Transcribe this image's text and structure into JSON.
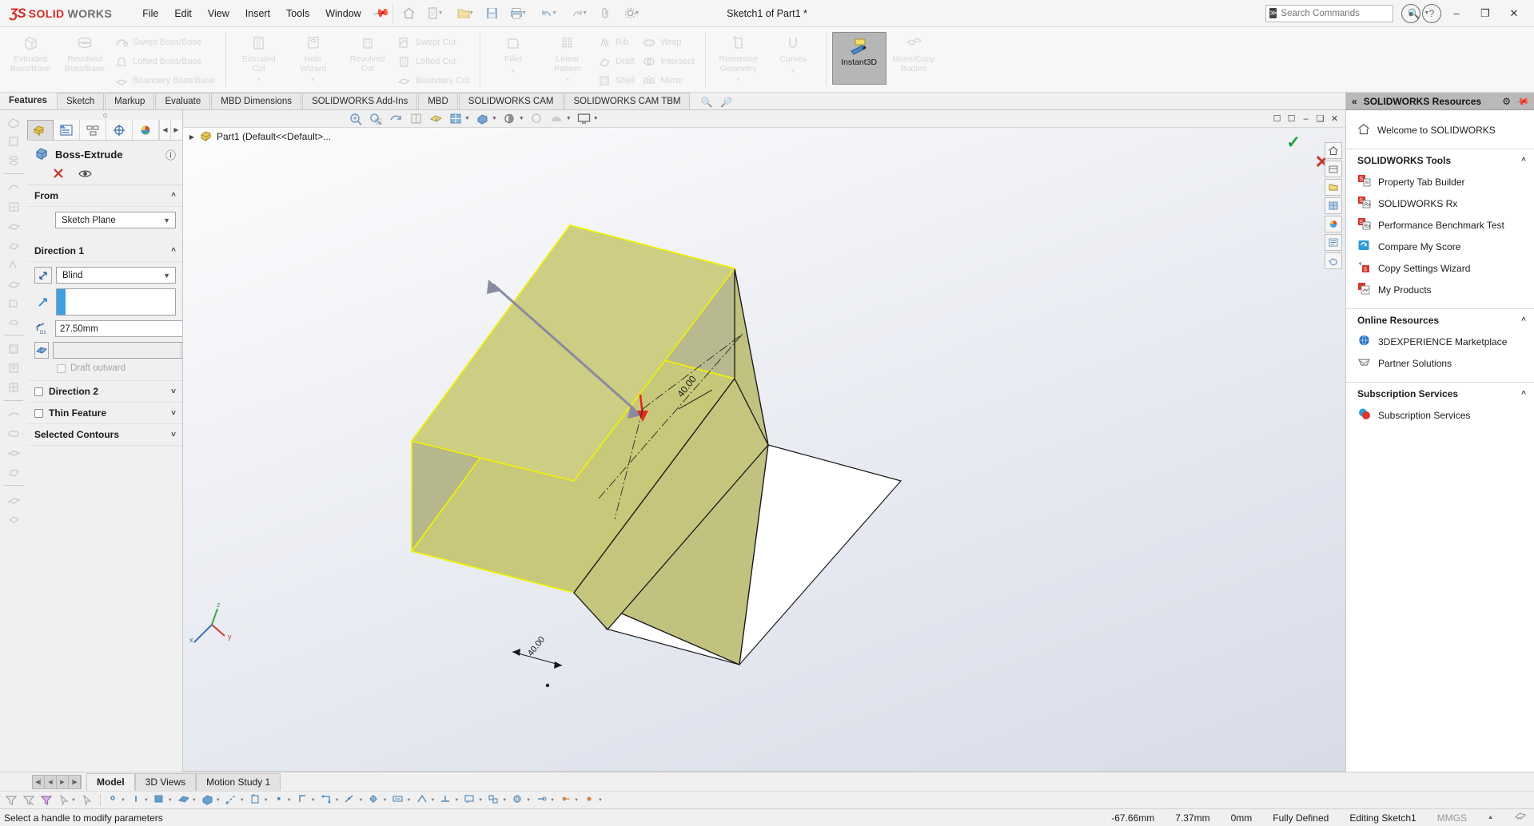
{
  "app": {
    "brand_ds": "ƷS",
    "brand_solid": "SOLID",
    "brand_works": "WORKS",
    "document_title": "Sketch1 of Part1 *",
    "accent_red": "#d32b28",
    "accent_blue": "#3e9fe0",
    "accent_green": "#1a9c2b"
  },
  "menubar": {
    "items": [
      {
        "label": "File"
      },
      {
        "label": "Edit"
      },
      {
        "label": "View"
      },
      {
        "label": "Insert"
      },
      {
        "label": "Tools"
      },
      {
        "label": "Window"
      }
    ],
    "pin_icon": "pin-icon"
  },
  "search": {
    "placeholder": "Search Commands",
    "value": ""
  },
  "window_controls": {
    "minimize": "–",
    "restore": "❐",
    "close": "✕",
    "account": "account-icon",
    "help": "help-icon"
  },
  "ribbon": {
    "groups": [
      {
        "name": "features-primary",
        "big": [
          {
            "label": "Extruded\nBoss/Base",
            "icon": "extruded-boss-icon",
            "dropdown": false
          },
          {
            "label": "Revolved\nBoss/Base",
            "icon": "revolved-boss-icon",
            "dropdown": false
          }
        ],
        "small": [
          {
            "label": "Swept Boss/Base",
            "icon": "swept-boss-icon"
          },
          {
            "label": "Lofted Boss/Base",
            "icon": "lofted-boss-icon"
          },
          {
            "label": "Boundary Boss/Base",
            "icon": "boundary-boss-icon"
          }
        ]
      },
      {
        "name": "cut-features",
        "big": [
          {
            "label": "Extruded\nCut",
            "icon": "extruded-cut-icon",
            "dropdown": true
          },
          {
            "label": "Hole\nWizard",
            "icon": "hole-wizard-icon",
            "dropdown": true
          },
          {
            "label": "Revolved\nCut",
            "icon": "revolved-cut-icon",
            "dropdown": false
          }
        ],
        "small": [
          {
            "label": "Swept Cut",
            "icon": "swept-cut-icon"
          },
          {
            "label": "Lofted Cut",
            "icon": "lofted-cut-icon"
          },
          {
            "label": "Boundary Cut",
            "icon": "boundary-cut-icon"
          }
        ]
      },
      {
        "name": "modify-features",
        "big": [
          {
            "label": "Fillet",
            "icon": "fillet-icon",
            "dropdown": true
          },
          {
            "label": "Linear\nPattern",
            "icon": "linear-pattern-icon",
            "dropdown": true
          }
        ],
        "small": [
          {
            "label": "Rib",
            "icon": "rib-icon"
          },
          {
            "label": "Draft",
            "icon": "draft-icon"
          },
          {
            "label": "Shell",
            "icon": "shell-icon"
          }
        ],
        "small2": [
          {
            "label": "Wrap",
            "icon": "wrap-icon"
          },
          {
            "label": "Intersect",
            "icon": "intersect-icon"
          },
          {
            "label": "Mirror",
            "icon": "mirror-icon"
          }
        ]
      },
      {
        "name": "reference-tools",
        "big": [
          {
            "label": "Reference\nGeometry",
            "icon": "reference-geometry-icon",
            "dropdown": true
          },
          {
            "label": "Curves",
            "icon": "curves-icon",
            "dropdown": true
          }
        ]
      },
      {
        "name": "instant3d-group",
        "big": [
          {
            "label": "Instant3D",
            "icon": "instant3d-icon",
            "active": true
          },
          {
            "label": "Move/Copy\nBodies",
            "icon": "move-copy-bodies-icon",
            "active": false
          }
        ]
      }
    ]
  },
  "command_tabs": {
    "items": [
      {
        "label": "Features",
        "selected": true
      },
      {
        "label": "Sketch",
        "selected": false
      },
      {
        "label": "Markup",
        "selected": false
      },
      {
        "label": "Evaluate",
        "selected": false
      },
      {
        "label": "MBD Dimensions",
        "selected": false
      },
      {
        "label": "SOLIDWORKS Add-Ins",
        "selected": false
      },
      {
        "label": "MBD",
        "selected": false
      },
      {
        "label": "SOLIDWORKS CAM",
        "selected": false
      },
      {
        "label": "SOLIDWORKS CAM TBM",
        "selected": false
      }
    ]
  },
  "property_manager": {
    "tabs": [
      {
        "name": "feature-manager-tab",
        "selected": true
      },
      {
        "name": "property-manager-tab",
        "selected": false
      },
      {
        "name": "configuration-manager-tab",
        "selected": false
      },
      {
        "name": "dimxpert-manager-tab",
        "selected": false
      },
      {
        "name": "display-manager-tab",
        "selected": false
      }
    ],
    "title": "Boss-Extrude",
    "title_icon": "boss-extrude-icon",
    "help_icon": "help-icon",
    "accept_icon": "checkmark-icon",
    "cancel_icon": "cancel-icon",
    "preview_icon": "eye-icon",
    "sections": {
      "from": {
        "label": "From",
        "condition_value": "Sketch Plane",
        "collapsed": false
      },
      "direction1": {
        "label": "Direction 1",
        "end_condition": "Blind",
        "direction_icon": "reverse-direction-icon",
        "depth_label": "D1",
        "depth_value": "27.50mm",
        "draft_value": "",
        "draft_outward_label": "Draft outward",
        "draft_outward_checked": false,
        "collapsed": false
      },
      "direction2": {
        "label": "Direction 2",
        "checked": false,
        "collapsed": true
      },
      "thin_feature": {
        "label": "Thin Feature",
        "checked": false,
        "collapsed": true
      },
      "selected_contours": {
        "label": "Selected Contours",
        "collapsed": true
      }
    }
  },
  "graphics": {
    "tree_root": "Part1  (Default<<Default>...",
    "tree_icon": "part-icon",
    "ok_badge": "✓",
    "cancel_badge": "✕",
    "hud_tools": [
      {
        "name": "zoom-to-fit-icon",
        "dropdown": false
      },
      {
        "name": "zoom-to-area-icon",
        "dropdown": false
      },
      {
        "name": "previous-view-icon",
        "dropdown": false
      },
      {
        "name": "section-view-icon",
        "dropdown": false
      },
      {
        "name": "view-orientation-icon",
        "dropdown": false
      },
      {
        "name": "display-style-icon",
        "dropdown": true
      },
      {
        "name": "hide-show-items-icon",
        "dropdown": true
      },
      {
        "name": "edit-appearance-icon",
        "dropdown": true
      },
      {
        "name": "apply-scene-icon",
        "dropdown": false
      },
      {
        "name": "view-settings-icon",
        "dropdown": true
      }
    ],
    "window_buttons": [
      {
        "name": "restore-view-icon",
        "glyph": "❐"
      },
      {
        "name": "maximize-view-icon",
        "glyph": "□"
      },
      {
        "name": "minimize-view-icon",
        "glyph": "–"
      },
      {
        "name": "restore-down-view-icon",
        "glyph": "❐"
      },
      {
        "name": "close-view-icon",
        "glyph": "✕"
      }
    ],
    "model": {
      "body_color": "#c8c87a",
      "highlight_edge_color": "#f2f200",
      "outline_color": "#1a1a1a",
      "drag_handle_color": "#8a8aa0",
      "arrow_color": "#e02a1b",
      "dimension_value": "40.00"
    },
    "triad": {
      "x_label": "x",
      "y_label": "y",
      "z_label": "z"
    }
  },
  "task_pane": {
    "collapse_icon": "«",
    "title": "SOLIDWORKS Resources",
    "gear_icon": "gear-icon",
    "pin_icon": "pin-icon",
    "welcome": {
      "label": "Welcome to SOLIDWORKS",
      "icon": "home-icon"
    },
    "sections": [
      {
        "label": "SOLIDWORKS Tools",
        "items": [
          {
            "label": "Property Tab Builder",
            "icon": "property-tab-builder-icon",
            "color": "#d8352c"
          },
          {
            "label": "SOLIDWORKS Rx",
            "icon": "solidworks-rx-icon",
            "color": "#d8352c"
          },
          {
            "label": "Performance Benchmark Test",
            "icon": "performance-benchmark-icon",
            "color": "#d8352c"
          },
          {
            "label": "Compare My Score",
            "icon": "compare-my-score-icon",
            "color": "#2e9cd6"
          },
          {
            "label": "Copy Settings Wizard",
            "icon": "copy-settings-wizard-icon",
            "color": "#d8352c"
          },
          {
            "label": "My Products",
            "icon": "my-products-icon",
            "color": "#d8352c"
          }
        ]
      },
      {
        "label": "Online Resources",
        "items": [
          {
            "label": "3DEXPERIENCE Marketplace",
            "icon": "marketplace-globe-icon",
            "color": "#2b6fbd"
          },
          {
            "label": "Partner Solutions",
            "icon": "partner-solutions-icon",
            "color": "#8a8a8a"
          }
        ]
      },
      {
        "label": "Subscription Services",
        "items": [
          {
            "label": "Subscription Services",
            "icon": "subscription-services-icon",
            "color": "#2e9cd6"
          }
        ]
      }
    ],
    "rail": [
      {
        "name": "solidworks-resources-rail-icon"
      },
      {
        "name": "design-library-rail-icon"
      },
      {
        "name": "file-explorer-rail-icon"
      },
      {
        "name": "view-palette-rail-icon"
      },
      {
        "name": "appearances-rail-icon"
      },
      {
        "name": "custom-properties-rail-icon"
      },
      {
        "name": "3d-interconnect-rail-icon"
      }
    ]
  },
  "model_tabs": {
    "nav": [
      "◀│",
      "◀",
      "▶",
      "│▶"
    ],
    "items": [
      {
        "label": "Model",
        "selected": true
      },
      {
        "label": "3D Views",
        "selected": false
      },
      {
        "label": "Motion Study 1",
        "selected": false
      }
    ]
  },
  "bottom_toolbar": {
    "items": [
      {
        "name": "filter-icon",
        "dropdown": false
      },
      {
        "name": "clear-filter-icon",
        "dropdown": false
      },
      {
        "name": "filter-active-icon",
        "dropdown": false
      },
      {
        "name": "select-icon",
        "dropdown": true
      },
      {
        "name": "select-other-icon",
        "dropdown": false
      },
      {
        "name": "filter-vertices-icon",
        "dropdown": true
      },
      {
        "name": "filter-edges-icon",
        "dropdown": true
      },
      {
        "name": "filter-faces-icon",
        "dropdown": true
      },
      {
        "name": "filter-surface-bodies-icon",
        "dropdown": true
      },
      {
        "name": "filter-solid-bodies-icon",
        "dropdown": true
      },
      {
        "name": "filter-axes-icon",
        "dropdown": true
      },
      {
        "name": "filter-planes-icon",
        "dropdown": true
      },
      {
        "name": "filter-sketch-points-icon",
        "dropdown": true
      },
      {
        "name": "filter-sketch-segments-icon",
        "dropdown": true
      },
      {
        "name": "filter-midpoints-icon",
        "dropdown": true
      },
      {
        "name": "filter-center-marks-icon",
        "dropdown": true
      },
      {
        "name": "filter-centerlines-icon",
        "dropdown": true
      },
      {
        "name": "filter-dimensions-icon",
        "dropdown": true
      },
      {
        "name": "filter-surface-finish-icon",
        "dropdown": true
      },
      {
        "name": "filter-welds-icon",
        "dropdown": true
      },
      {
        "name": "filter-annotations-icon",
        "dropdown": true
      },
      {
        "name": "filter-blocks-icon",
        "dropdown": true
      },
      {
        "name": "filter-cosmetic-threads-icon",
        "dropdown": true
      },
      {
        "name": "filter-dowel-symbols-icon",
        "dropdown": true
      },
      {
        "name": "filter-connection-points-icon",
        "dropdown": true
      },
      {
        "name": "filter-routing-points-icon",
        "dropdown": true
      }
    ]
  },
  "status_bar": {
    "message": "Select a handle to modify parameters",
    "coord_x": "-67.66mm",
    "coord_y": "7.37mm",
    "coord_z": "0mm",
    "state": "Fully Defined",
    "editing": "Editing Sketch1",
    "units": "MMGS",
    "units_caret": "▲",
    "overlay_icon": "overlay-icon"
  }
}
